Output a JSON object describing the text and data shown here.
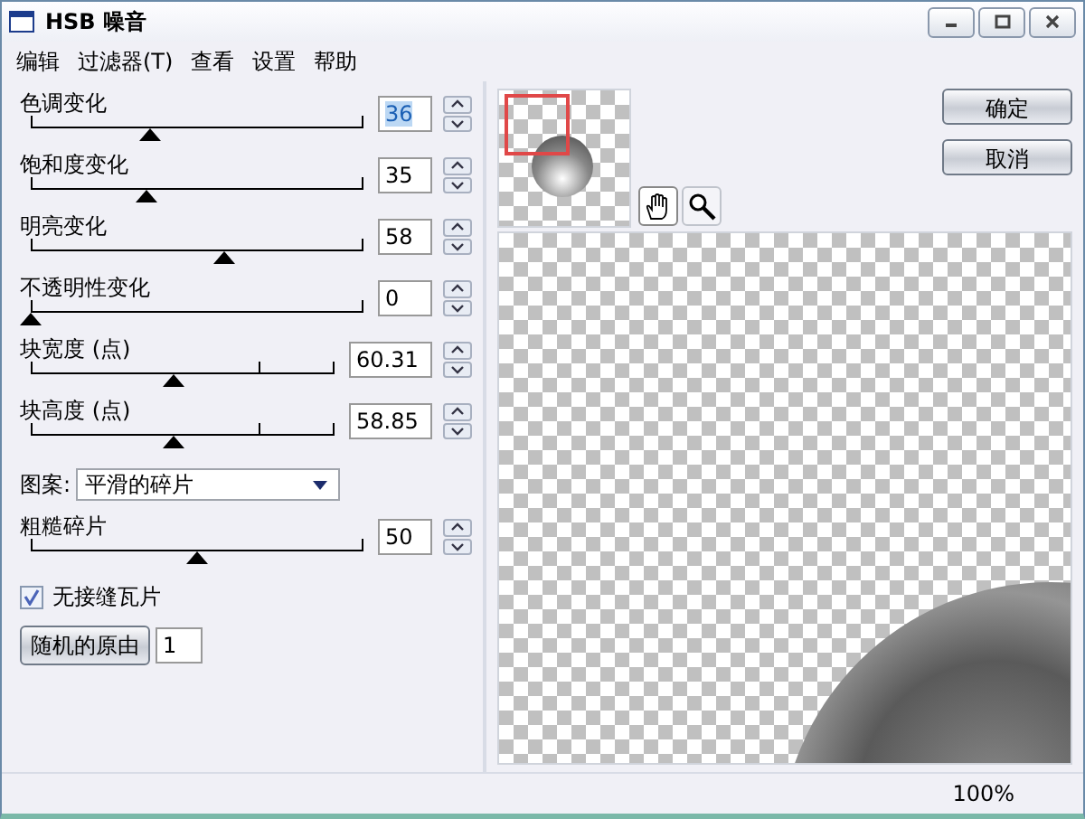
{
  "window": {
    "title": "HSB 噪音"
  },
  "menu": [
    {
      "label": "编辑"
    },
    {
      "label": "过滤器(T)"
    },
    {
      "label": "查看"
    },
    {
      "label": "设置"
    },
    {
      "label": "帮助"
    }
  ],
  "controls": [
    {
      "kind": "slider",
      "label": "色调变化",
      "value": "36",
      "level": 0.36,
      "value_selected": true,
      "ticked": false
    },
    {
      "kind": "slider",
      "label": "饱和度变化",
      "value": "35",
      "level": 0.35,
      "value_selected": false,
      "ticked": false
    },
    {
      "kind": "slider",
      "label": "明亮变化",
      "value": "58",
      "level": 0.58,
      "value_selected": false,
      "ticked": false
    },
    {
      "kind": "slider",
      "label": "不透明性变化",
      "value": "0",
      "level": 0,
      "value_selected": false,
      "ticked": false
    },
    {
      "kind": "slider",
      "label": "块宽度 (点)",
      "value": "60.31",
      "level": 0.47,
      "value_selected": false,
      "ticked": true
    },
    {
      "kind": "slider",
      "label": "块高度 (点)",
      "value": "58.85",
      "level": 0.47,
      "value_selected": false,
      "ticked": true
    },
    {
      "kind": "dropdown",
      "label": "图案:",
      "value": "平滑的碎片"
    },
    {
      "kind": "slider",
      "label": "粗糙碎片",
      "value": "50",
      "level": 0.5,
      "value_selected": false,
      "ticked": false
    },
    {
      "kind": "checkbox",
      "label": "无接缝瓦片",
      "checked": true
    },
    {
      "kind": "seed",
      "label": "随机的原由",
      "value": "1"
    }
  ],
  "buttons": [
    {
      "label": "确定"
    },
    {
      "label": "取消"
    }
  ],
  "tools": [
    {
      "kind": "hand",
      "selected": true
    },
    {
      "kind": "zoom",
      "selected": false
    }
  ],
  "status_bar": {
    "zoom": "100%"
  }
}
